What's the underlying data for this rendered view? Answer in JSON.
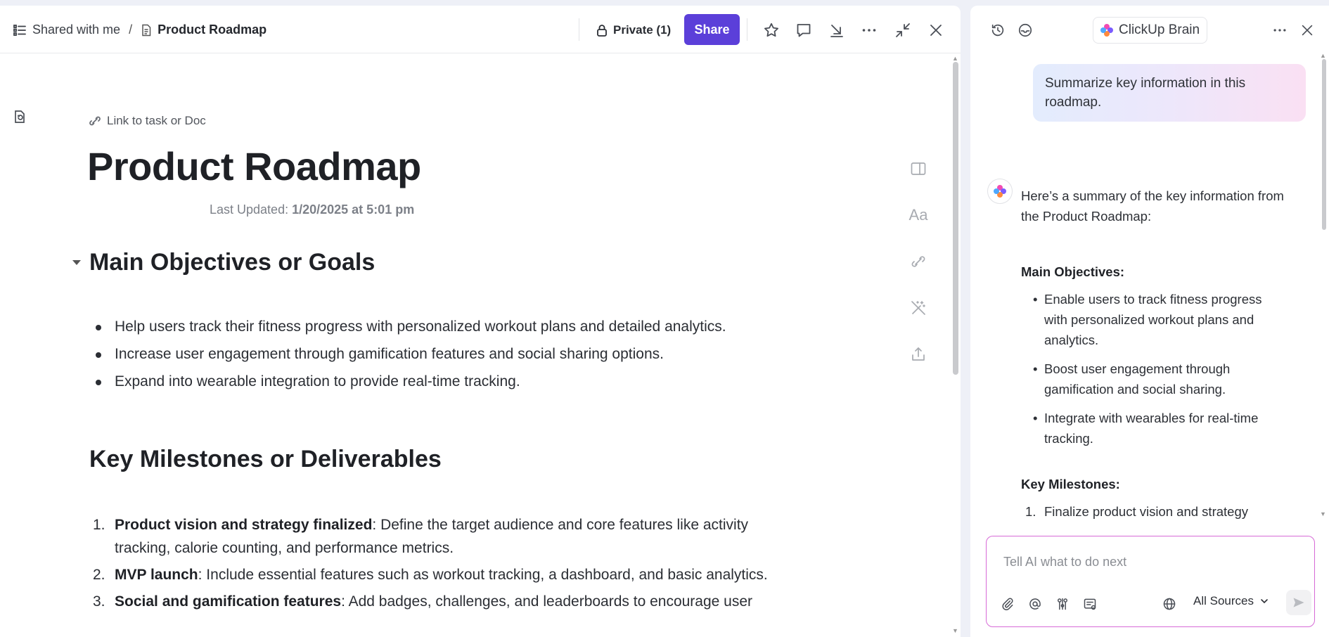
{
  "header": {
    "breadcrumb_root": "Shared with me",
    "breadcrumb_separator": "/",
    "breadcrumb_current": "Product Roadmap",
    "private_label": "Private (1)",
    "share_label": "Share",
    "icons": [
      "star-icon",
      "comment-icon",
      "download-icon",
      "more-icon",
      "collapse-icon",
      "close-icon"
    ]
  },
  "doc": {
    "link_label": "Link to task or Doc",
    "title": "Product Roadmap",
    "last_updated_label": "Last Updated:",
    "last_updated_value": "1/20/2025 at 5:01 pm",
    "section1_heading": "Main Objectives or Goals",
    "objectives": [
      "Help users track their fitness progress with personalized workout plans and detailed analytics.",
      "Increase user engagement through gamification features and social sharing options.",
      "Expand into wearable integration to provide real-time tracking."
    ],
    "section2_heading": "Key Milestones or Deliverables",
    "milestones": [
      {
        "num": "1.",
        "bold": "Product vision and strategy finalized",
        "text": ": Define the target audience and core features like activity tracking, calorie counting, and performance metrics."
      },
      {
        "num": "2.",
        "bold": "MVP launch",
        "text": ": Include essential features such as workout tracking, a dashboard, and basic analytics."
      },
      {
        "num": "3.",
        "bold": "Social and gamification features",
        "text": ": Add badges, challenges, and leaderboards to encourage user"
      }
    ],
    "side_tools": [
      "sidebar-toggle-icon",
      "font-style-icon",
      "link-icon",
      "magic-wand-icon",
      "export-icon"
    ],
    "font_tool_glyph": "Aa"
  },
  "ai_panel": {
    "title": "ClickUp Brain",
    "user_message": "Summarize key information in this roadmap.",
    "response_intro": "Here’s a summary of the key information from the Product Roadmap:",
    "objectives_heading": "Main Objectives:",
    "objectives": [
      "Enable users to track fitness progress with personalized workout plans and analytics.",
      "Boost user engagement through gamification and social sharing.",
      "Integrate with wearables for real-time tracking."
    ],
    "milestones_heading": "Key Milestones:",
    "milestones": [
      {
        "num": "1.",
        "text": "Finalize product vision and strategy"
      }
    ],
    "input_placeholder": "Tell AI what to do next",
    "sources_label": "All Sources",
    "brand_colors": [
      "#f24bb3",
      "#7b5cff",
      "#ff8a3d",
      "#4fa8ff"
    ]
  }
}
